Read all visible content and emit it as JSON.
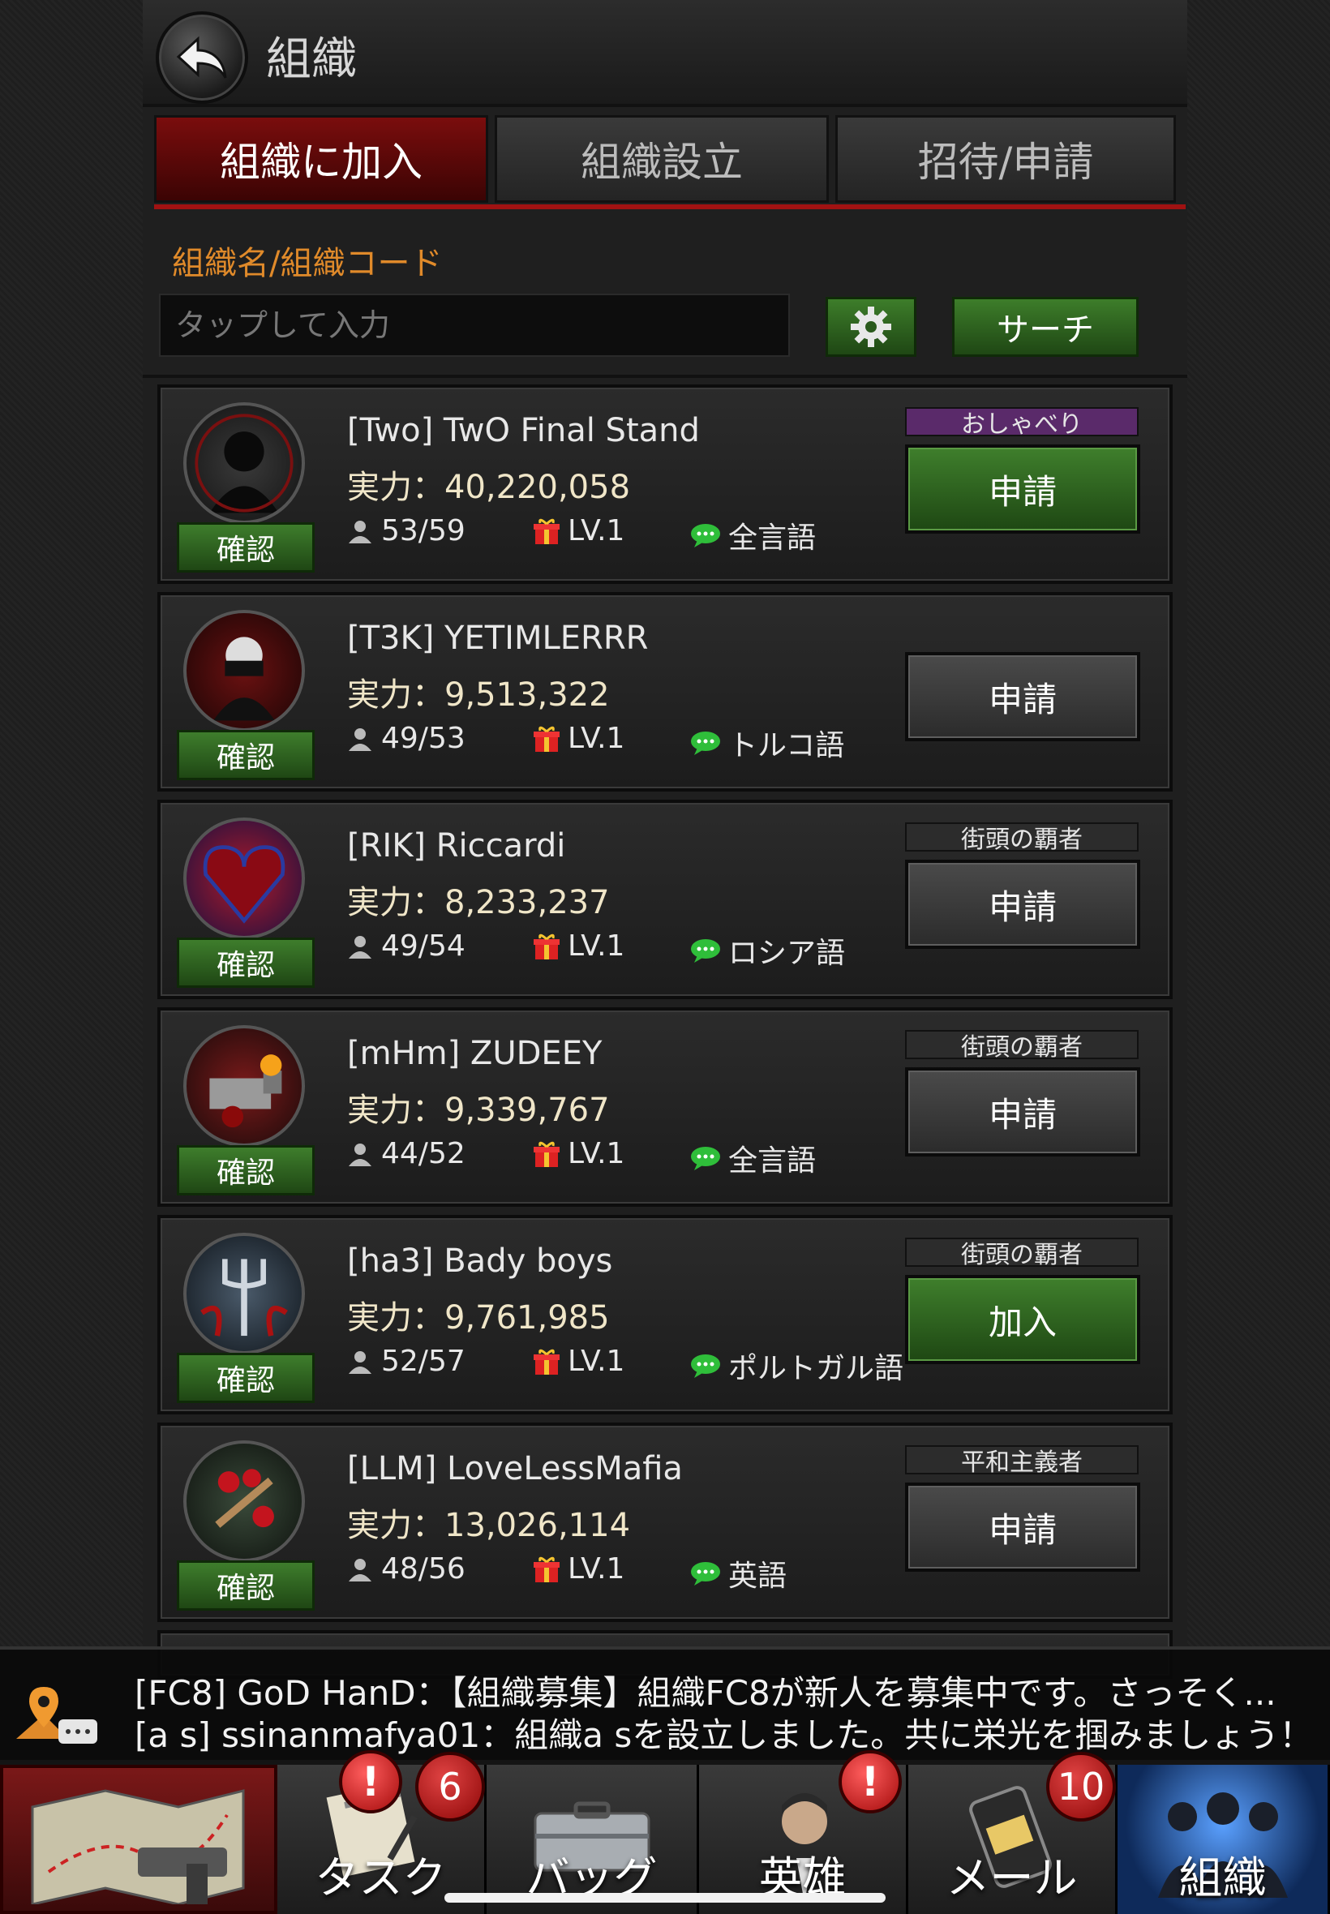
{
  "header": {
    "title": "組織"
  },
  "tabs": [
    {
      "label": "組織に加入",
      "active": true
    },
    {
      "label": "組織設立",
      "active": false
    },
    {
      "label": "招待/申請",
      "active": false
    }
  ],
  "search": {
    "label": "組織名/組織コード",
    "placeholder": "タップして入力",
    "button_label": "サーチ"
  },
  "organizations": [
    {
      "name": "[Two] TwO Final Stand",
      "power": "実力：40,220,058",
      "members": "53/59",
      "level": "LV.1",
      "language": "全言語",
      "tag": "おしゃべり",
      "tag_color": "#5a2a6a",
      "action": "申請",
      "action_style": "green",
      "confirm": "確認"
    },
    {
      "name": "[T3K] YETIMLERRR",
      "power": "実力：9,513,322",
      "members": "49/53",
      "level": "LV.1",
      "language": "トルコ語",
      "tag": "",
      "tag_color": "",
      "action": "申請",
      "action_style": "gray",
      "confirm": "確認"
    },
    {
      "name": "[RIK] Riccardi",
      "power": "実力：8,233,237",
      "members": "49/54",
      "level": "LV.1",
      "language": "ロシア語",
      "tag": "街頭の覇者",
      "tag_color": "#2c2c2c",
      "action": "申請",
      "action_style": "gray",
      "confirm": "確認"
    },
    {
      "name": "[mHm] ZUDEEY",
      "power": "実力：9,339,767",
      "members": "44/52",
      "level": "LV.1",
      "language": "全言語",
      "tag": "街頭の覇者",
      "tag_color": "#2c2c2c",
      "action": "申請",
      "action_style": "gray",
      "confirm": "確認"
    },
    {
      "name": "[ha3] Bady boys",
      "power": "実力：9,761,985",
      "members": "52/57",
      "level": "LV.1",
      "language": "ポルトガル語",
      "tag": "街頭の覇者",
      "tag_color": "#2c2c2c",
      "action": "加入",
      "action_style": "green",
      "confirm": "確認"
    },
    {
      "name": "[LLM] LoveLessMafia",
      "power": "実力：13,026,114",
      "members": "48/56",
      "level": "LV.1",
      "language": "英語",
      "tag": "平和主義者",
      "tag_color": "#2c2c2c",
      "action": "申請",
      "action_style": "gray",
      "confirm": "確認"
    }
  ],
  "chat": {
    "line1": "[FC8] GoD HanD：【組織募集】組織FC8が新人を募集中です。さっそく...",
    "line2": "[a s] ssinanmafya01：組織a sを設立しました。共に栄光を掴みましょう！"
  },
  "nav": [
    {
      "label": "",
      "icon": "map-icon"
    },
    {
      "label": "タスク",
      "icon": "task-icon",
      "alert": "!",
      "count": "6"
    },
    {
      "label": "バッグ",
      "icon": "bag-icon"
    },
    {
      "label": "英雄",
      "icon": "hero-icon",
      "alert": "!"
    },
    {
      "label": "メール",
      "icon": "mail-icon",
      "count": "10"
    },
    {
      "label": "組織",
      "icon": "organization-icon"
    }
  ],
  "colors": {
    "accent_red": "#a01212",
    "button_green": "#3d7d2a",
    "label_orange": "#e08a2a"
  }
}
